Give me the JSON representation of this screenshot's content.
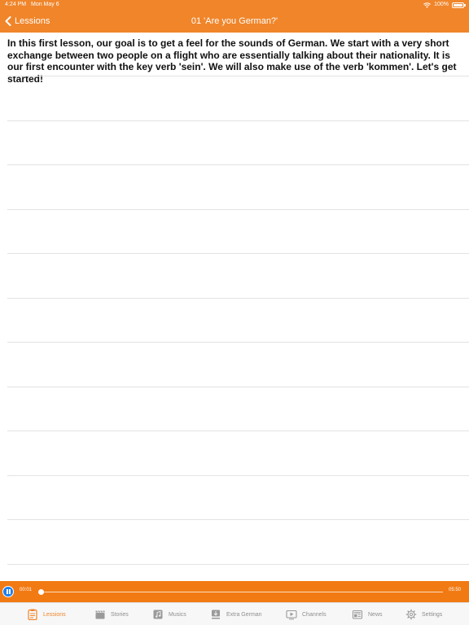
{
  "status_bar": {
    "time": "4:24 PM",
    "date": "Mon May 6",
    "battery": "100%"
  },
  "nav": {
    "back_label": "Lessions",
    "title": "01 'Are you German?'"
  },
  "lesson": {
    "intro": "In this first lesson, our goal is to get a feel for the sounds of German. We start with a very short exchange between two people on a flight who are essentially talking about their nationality. It is our first encounter with the key verb 'sein'. We will also make use of the verb 'kommen'. Let's get started!"
  },
  "player": {
    "current_time": "00:01",
    "total_time": "05:50",
    "progress": 0.006,
    "state": "playing"
  },
  "tabs": [
    {
      "label": "Lessions",
      "icon": "lessons-icon",
      "active": true
    },
    {
      "label": "Stories",
      "icon": "clapperboard-icon",
      "active": false
    },
    {
      "label": "Musics",
      "icon": "music-note-icon",
      "active": false
    },
    {
      "label": "Extra German",
      "icon": "download-icon",
      "active": false
    },
    {
      "label": "Channels",
      "icon": "play-screen-icon",
      "active": false
    },
    {
      "label": "News",
      "icon": "newspaper-icon",
      "active": false
    },
    {
      "label": "Settings",
      "icon": "gear-icon",
      "active": false
    }
  ],
  "colors": {
    "accent": "#f0852a",
    "player_bar": "#f27a12",
    "play_button": "#1e7ff0",
    "tab_inactive": "#8e8e8e"
  }
}
